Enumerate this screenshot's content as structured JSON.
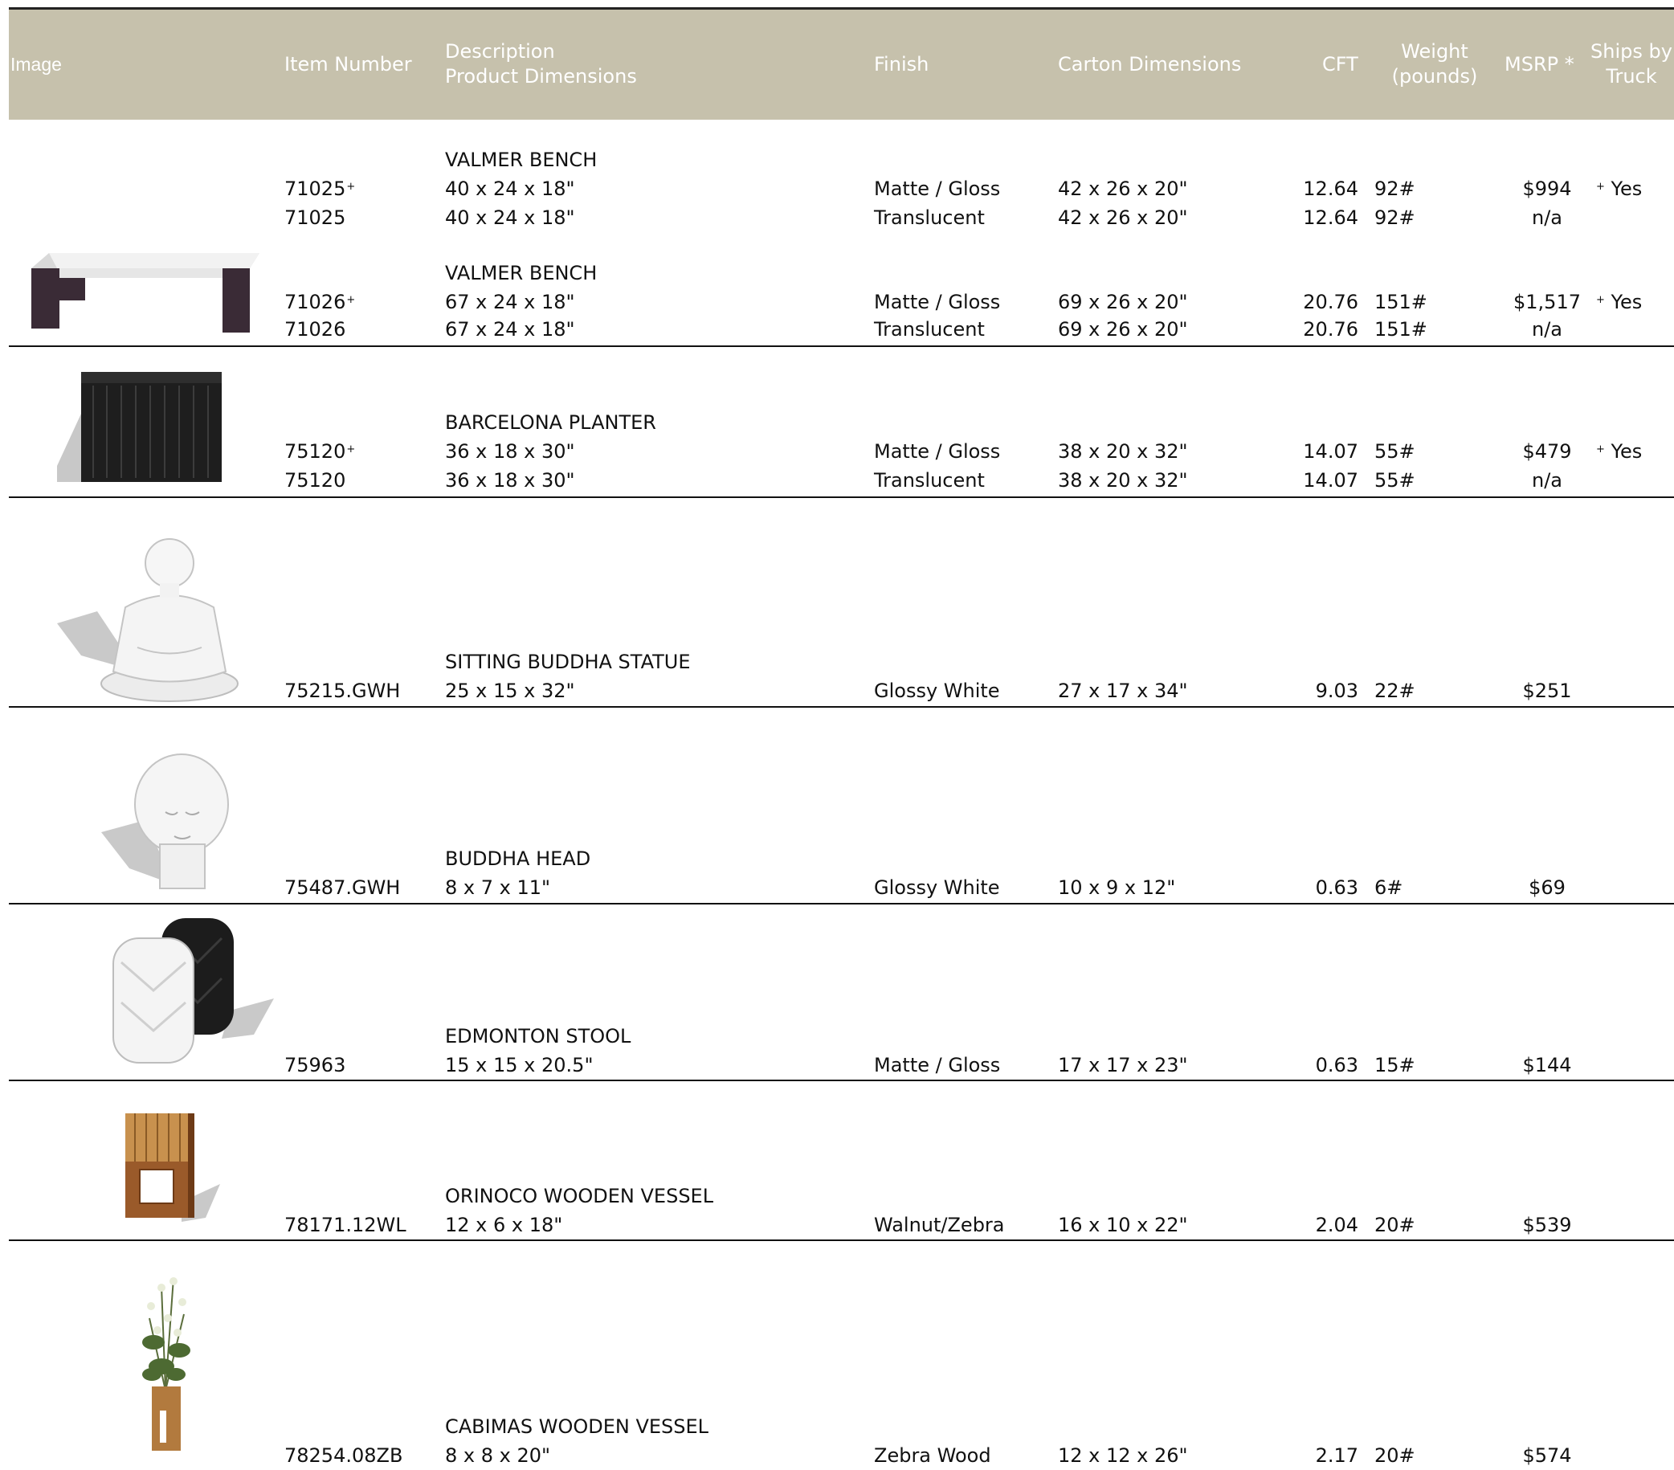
{
  "header": {
    "image": "Image",
    "item_number": "Item Number",
    "description_line1": "Description",
    "description_line2": "Product Dimensions",
    "finish": "Finish",
    "carton": "Carton Dimensions",
    "cft": "CFT",
    "weight_line1": "Weight",
    "weight_line2": "(pounds)",
    "msrp": "MSRP *",
    "ships_line1": "Ships by",
    "ships_line2": "Truck"
  },
  "products": [
    {
      "name": "VALMER BENCH",
      "lines": [
        {
          "item": "71025",
          "plus": "+",
          "dims": "40 x 24 x 18\"",
          "finish": "Matte / Gloss",
          "carton": "42 x 26 x 20\"",
          "cft": "12.64",
          "weight": "92#",
          "msrp": "$994",
          "ships_plus": "+",
          "ships": "Yes"
        },
        {
          "item": "71025",
          "plus": "",
          "dims": "40 x 24 x 18\"",
          "finish": "Translucent",
          "carton": "42 x 26 x 20\"",
          "cft": "12.64",
          "weight": "92#",
          "msrp": "n/a",
          "ships_plus": "",
          "ships": ""
        }
      ]
    },
    {
      "name": "VALMER BENCH",
      "lines": [
        {
          "item": "71026",
          "plus": "+",
          "dims": "67 x 24 x 18\"",
          "finish": "Matte / Gloss",
          "carton": "69 x 26 x 20\"",
          "cft": "20.76",
          "weight": "151#",
          "msrp": "$1,517",
          "ships_plus": "+",
          "ships": "Yes"
        },
        {
          "item": "71026",
          "plus": "",
          "dims": "67 x 24 x 18\"",
          "finish": "Translucent",
          "carton": "69 x 26 x 20\"",
          "cft": "20.76",
          "weight": "151#",
          "msrp": "n/a",
          "ships_plus": "",
          "ships": ""
        }
      ]
    },
    {
      "name": "BARCELONA PLANTER",
      "lines": [
        {
          "item": "75120",
          "plus": "+",
          "dims": "36 x 18 x 30\"",
          "finish": "Matte / Gloss",
          "carton": "38 x 20 x 32\"",
          "cft": "14.07",
          "weight": "55#",
          "msrp": "$479",
          "ships_plus": "+",
          "ships": "Yes"
        },
        {
          "item": "75120",
          "plus": "",
          "dims": "36 x 18 x 30\"",
          "finish": "Translucent",
          "carton": "38 x 20 x 32\"",
          "cft": "14.07",
          "weight": "55#",
          "msrp": "n/a",
          "ships_plus": "",
          "ships": ""
        }
      ]
    },
    {
      "name": "SITTING BUDDHA STATUE",
      "lines": [
        {
          "item": "75215.GWH",
          "plus": "",
          "dims": "25 x 15 x 32\"",
          "finish": "Glossy White",
          "carton": "27 x 17 x 34\"",
          "cft": "9.03",
          "weight": "22#",
          "msrp": "$251",
          "ships_plus": "",
          "ships": ""
        }
      ]
    },
    {
      "name": "BUDDHA HEAD",
      "lines": [
        {
          "item": "75487.GWH",
          "plus": "",
          "dims": "8 x 7 x 11\"",
          "finish": "Glossy White",
          "carton": "10 x 9 x 12\"",
          "cft": "0.63",
          "weight": "6#",
          "msrp": "$69",
          "ships_plus": "",
          "ships": ""
        }
      ]
    },
    {
      "name": "EDMONTON STOOL",
      "lines": [
        {
          "item": "75963",
          "plus": "",
          "dims": "15 x 15 x 20.5\"",
          "finish": "Matte / Gloss",
          "carton": "17 x 17 x 23\"",
          "cft": "0.63",
          "weight": "15#",
          "msrp": "$144",
          "ships_plus": "",
          "ships": ""
        }
      ]
    },
    {
      "name": "ORINOCO WOODEN VESSEL",
      "lines": [
        {
          "item": "78171.12WL",
          "plus": "",
          "dims": "12 x 6 x 18\"",
          "finish": "Walnut/Zebra",
          "carton": "16 x 10 x 22\"",
          "cft": "2.04",
          "weight": "20#",
          "msrp": "$539",
          "ships_plus": "",
          "ships": ""
        }
      ]
    },
    {
      "name": "CABIMAS WOODEN VESSEL",
      "lines": [
        {
          "item": "78254.08ZB",
          "plus": "",
          "dims": "8 x 8 x 20\"",
          "finish": "Zebra Wood",
          "carton": "12 x 12 x 26\"",
          "cft": "2.17",
          "weight": "20#",
          "msrp": "$574",
          "ships_plus": "",
          "ships": ""
        }
      ]
    }
  ],
  "colors": {
    "header_bg": "#c6c1ac",
    "header_text": "#ffffff",
    "rule": "#111111"
  },
  "icons": [
    "bench-image",
    "planter-image",
    "buddha-statue-image",
    "buddha-head-image",
    "stool-image",
    "wooden-vessel-image",
    "vessel-with-plant-image"
  ]
}
